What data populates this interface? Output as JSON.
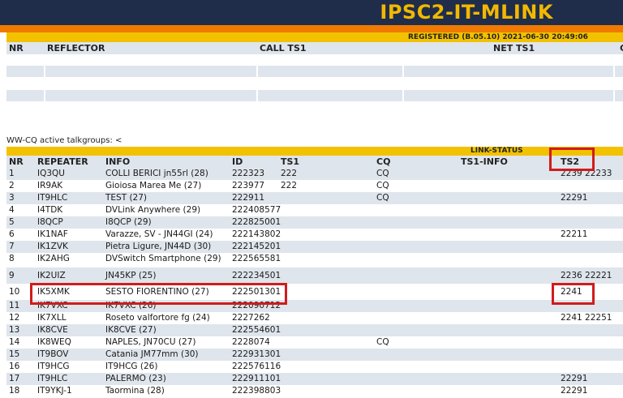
{
  "header": {
    "title": "IPSC2-IT-MLINK"
  },
  "registered": {
    "text": "REGISTERED (B.05.10) 2021-06-30 20:49:06"
  },
  "reflector_table": {
    "columns": [
      "NR",
      "REFLECTOR",
      "CALL TS1",
      "NET TS1",
      "C"
    ]
  },
  "ww_cq": {
    "text": "WW-CQ active talkgroups: <"
  },
  "link_status": {
    "title": "LINK-STATUS",
    "columns": [
      "NR",
      "REPEATER",
      "INFO",
      "ID",
      "TS1",
      "CQ",
      "TS1-INFO",
      "TS2"
    ],
    "rows": [
      {
        "nr": "1",
        "repeater": "IQ3QU",
        "info": "COLLI BERICI jn55rl (28)",
        "id": "222323",
        "ts1": "222",
        "cq": "CQ",
        "ts1info": "",
        "ts2": "2239 22233"
      },
      {
        "nr": "2",
        "repeater": "IR9AK",
        "info": "Gioiosa Marea Me (27)",
        "id": "223977",
        "ts1": "222",
        "cq": "CQ",
        "ts1info": "",
        "ts2": ""
      },
      {
        "nr": "3",
        "repeater": "IT9HLC",
        "info": "TEST (27)",
        "id": "222911",
        "ts1": "",
        "cq": "CQ",
        "ts1info": "",
        "ts2": "22291"
      },
      {
        "nr": "4",
        "repeater": "I4TDK",
        "info": "DVLink Anywhere (29)",
        "id": "222408577",
        "ts1": "",
        "cq": "",
        "ts1info": "",
        "ts2": ""
      },
      {
        "nr": "5",
        "repeater": "I8QCP",
        "info": "I8QCP (29)",
        "id": "222825001",
        "ts1": "",
        "cq": "",
        "ts1info": "",
        "ts2": ""
      },
      {
        "nr": "6",
        "repeater": "IK1NAF",
        "info": "Varazze, SV - JN44GI (24)",
        "id": "222143802",
        "ts1": "",
        "cq": "",
        "ts1info": "",
        "ts2": "22211"
      },
      {
        "nr": "7",
        "repeater": "IK1ZVK",
        "info": "Pietra Ligure, JN44D (30)",
        "id": "222145201",
        "ts1": "",
        "cq": "",
        "ts1info": "",
        "ts2": ""
      },
      {
        "nr": "8",
        "repeater": "IK2AHG",
        "info": "DVSwitch Smartphone (29)",
        "id": "222565581",
        "ts1": "",
        "cq": "",
        "ts1info": "",
        "ts2": ""
      },
      {
        "nr": "9",
        "repeater": "IK2UIZ",
        "info": "JN45KP (25)",
        "id": "222234501",
        "ts1": "",
        "cq": "",
        "ts1info": "",
        "ts2": "2236 22221"
      },
      {
        "nr": "10",
        "repeater": "IK5XMK",
        "info": "SESTO FIORENTINO (27)",
        "id": "222501301",
        "ts1": "",
        "cq": "",
        "ts1info": "",
        "ts2": "2241"
      },
      {
        "nr": "11",
        "repeater": "IK7VXC",
        "info": "IK7VXC (26)",
        "id": "222090712",
        "ts1": "",
        "cq": "",
        "ts1info": "",
        "ts2": ""
      },
      {
        "nr": "12",
        "repeater": "IK7XLL",
        "info": "Roseto valfortore fg (24)",
        "id": "2227262",
        "ts1": "",
        "cq": "",
        "ts1info": "",
        "ts2": "2241 22251"
      },
      {
        "nr": "13",
        "repeater": "IK8CVE",
        "info": "IK8CVE (27)",
        "id": "222554601",
        "ts1": "",
        "cq": "",
        "ts1info": "",
        "ts2": ""
      },
      {
        "nr": "14",
        "repeater": "IK8WEQ",
        "info": "NAPLES, JN70CU (27)",
        "id": "2228074",
        "ts1": "",
        "cq": "CQ",
        "ts1info": "",
        "ts2": ""
      },
      {
        "nr": "15",
        "repeater": "IT9BOV",
        "info": "Catania JM77mm (30)",
        "id": "222931301",
        "ts1": "",
        "cq": "",
        "ts1info": "",
        "ts2": ""
      },
      {
        "nr": "16",
        "repeater": "IT9HCG",
        "info": "IT9HCG (26)",
        "id": "222576116",
        "ts1": "",
        "cq": "",
        "ts1info": "",
        "ts2": ""
      },
      {
        "nr": "17",
        "repeater": "IT9HLC",
        "info": "PALERMO (23)",
        "id": "222911101",
        "ts1": "",
        "cq": "",
        "ts1info": "",
        "ts2": "22291"
      },
      {
        "nr": "18",
        "repeater": "IT9YKJ-1",
        "info": "Taormina (28)",
        "id": "222398803",
        "ts1": "",
        "cq": "",
        "ts1info": "",
        "ts2": "22291"
      }
    ]
  },
  "colors": {
    "header_bg": "#1f2d4a",
    "title": "#f2b800",
    "orange_bar": "#f07a00",
    "yellow_bar": "#f2c200",
    "row_alt": "#dfe5ec",
    "highlight": "#d01c1c"
  }
}
